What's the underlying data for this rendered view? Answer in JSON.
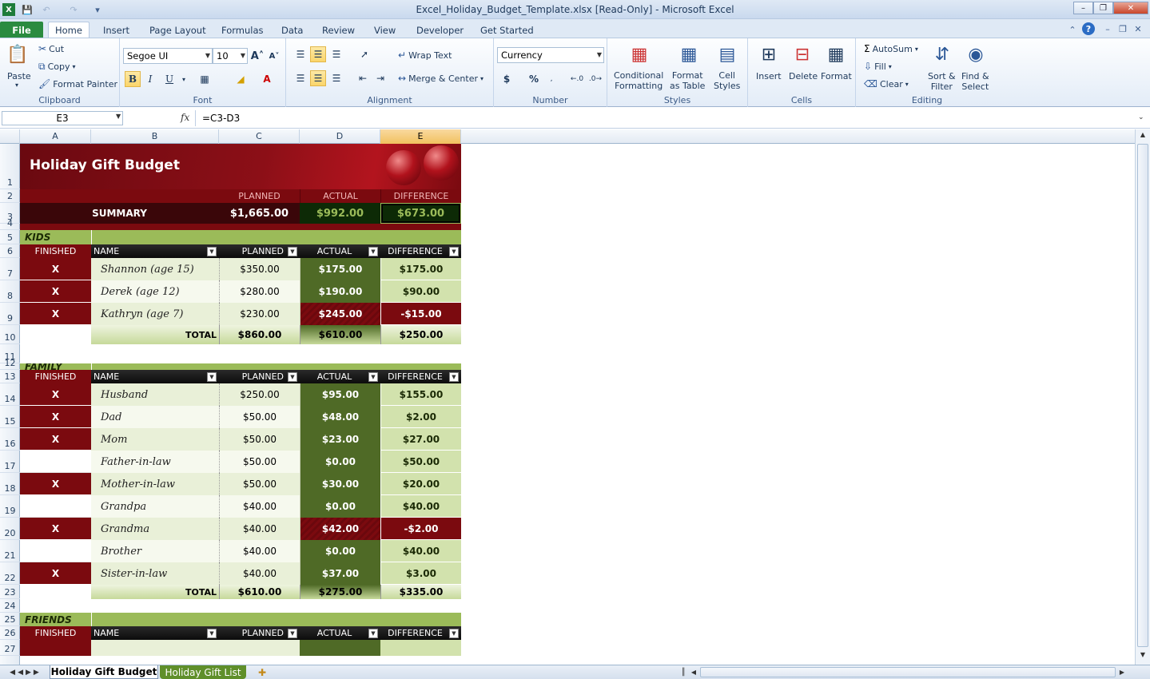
{
  "window": {
    "title": "Excel_Holiday_Budget_Template.xlsx  [Read-Only]  -  Microsoft Excel"
  },
  "tabs": [
    {
      "label": "File"
    },
    {
      "label": "Home"
    },
    {
      "label": "Insert"
    },
    {
      "label": "Page Layout"
    },
    {
      "label": "Formulas"
    },
    {
      "label": "Data"
    },
    {
      "label": "Review"
    },
    {
      "label": "View"
    },
    {
      "label": "Developer"
    },
    {
      "label": "Get Started"
    }
  ],
  "ribbon": {
    "clipboard": {
      "paste": "Paste",
      "cut": "Cut",
      "copy": "Copy",
      "format_painter": "Format Painter",
      "label": "Clipboard"
    },
    "font": {
      "name": "Segoe UI",
      "size": "10",
      "label": "Font"
    },
    "alignment": {
      "wrap_text": "Wrap Text",
      "merge_center": "Merge & Center",
      "label": "Alignment"
    },
    "number": {
      "format": "Currency",
      "currency": "$",
      "percent": "%",
      "label": "Number"
    },
    "styles": {
      "conditional_1": "Conditional",
      "conditional_2": "Formatting",
      "format_table_1": "Format",
      "format_table_2": "as Table",
      "cell_styles_1": "Cell",
      "cell_styles_2": "Styles",
      "label": "Styles"
    },
    "cells": {
      "insert": "Insert",
      "delete": "Delete",
      "format": "Format",
      "label": "Cells"
    },
    "editing": {
      "autosum": "AutoSum",
      "fill": "Fill",
      "clear": "Clear",
      "sort_1": "Sort &",
      "sort_2": "Filter",
      "find_1": "Find &",
      "find_2": "Select",
      "label": "Editing"
    }
  },
  "formula_bar": {
    "name_box": "E3",
    "fx": "fx",
    "formula": "=C3-D3"
  },
  "columns": [
    "A",
    "B",
    "C",
    "D",
    "E"
  ],
  "rows": [
    "1",
    "2",
    "3",
    "4",
    "5",
    "6",
    "7",
    "8",
    "9",
    "10",
    "11",
    "12",
    "13",
    "14",
    "15",
    "16",
    "17",
    "18",
    "19",
    "20",
    "21",
    "22",
    "23",
    "24",
    "25",
    "26",
    "27"
  ],
  "sheet": {
    "title": "Holiday Gift Budget",
    "summary": {
      "label": "SUMMARY",
      "h_planned": "PLANNED",
      "h_actual": "ACTUAL",
      "h_diff": "DIFFERENCE",
      "planned": "$1,665.00",
      "actual": "$992.00",
      "diff": "$673.00"
    },
    "headers": {
      "finished": "FINISHED",
      "name": "NAME",
      "planned": "PLANNED",
      "actual": "ACTUAL",
      "diff": "DIFFERENCE"
    },
    "kids": {
      "title": "KIDS",
      "items": [
        {
          "finished": "X",
          "name": "Shannon (age 15)",
          "planned": "$350.00",
          "actual": "$175.00",
          "diff": "$175.00"
        },
        {
          "finished": "X",
          "name": "Derek (age 12)",
          "planned": "$280.00",
          "actual": "$190.00",
          "diff": "$90.00"
        },
        {
          "finished": "X",
          "name": "Kathryn (age 7)",
          "planned": "$230.00",
          "actual": "$245.00",
          "diff": "-$15.00"
        }
      ],
      "total": {
        "label": "TOTAL",
        "planned": "$860.00",
        "actual": "$610.00",
        "diff": "$250.00"
      }
    },
    "family": {
      "title": "FAMILY",
      "items": [
        {
          "finished": "X",
          "name": "Husband",
          "planned": "$250.00",
          "actual": "$95.00",
          "diff": "$155.00"
        },
        {
          "finished": "X",
          "name": "Dad",
          "planned": "$50.00",
          "actual": "$48.00",
          "diff": "$2.00"
        },
        {
          "finished": "X",
          "name": "Mom",
          "planned": "$50.00",
          "actual": "$23.00",
          "diff": "$27.00"
        },
        {
          "finished": "",
          "name": "Father-in-law",
          "planned": "$50.00",
          "actual": "$0.00",
          "diff": "$50.00"
        },
        {
          "finished": "X",
          "name": "Mother-in-law",
          "planned": "$50.00",
          "actual": "$30.00",
          "diff": "$20.00"
        },
        {
          "finished": "",
          "name": "Grandpa",
          "planned": "$40.00",
          "actual": "$0.00",
          "diff": "$40.00"
        },
        {
          "finished": "X",
          "name": "Grandma",
          "planned": "$40.00",
          "actual": "$42.00",
          "diff": "-$2.00"
        },
        {
          "finished": "",
          "name": "Brother",
          "planned": "$40.00",
          "actual": "$0.00",
          "diff": "$40.00"
        },
        {
          "finished": "X",
          "name": "Sister-in-law",
          "planned": "$40.00",
          "actual": "$37.00",
          "diff": "$3.00"
        }
      ],
      "total": {
        "label": "TOTAL",
        "planned": "$610.00",
        "actual": "$275.00",
        "diff": "$335.00"
      }
    },
    "friends": {
      "title": "FRIENDS"
    }
  },
  "sheet_tabs": [
    {
      "label": "Holiday Gift Budget"
    },
    {
      "label": "Holiday Gift List"
    }
  ],
  "colors": {
    "dark_red": "#7b0a0f",
    "olive": "#4f6a26",
    "light_green": "#d2e2ad",
    "section_green": "#9bbb59",
    "header_black": "#1b1b1b"
  }
}
